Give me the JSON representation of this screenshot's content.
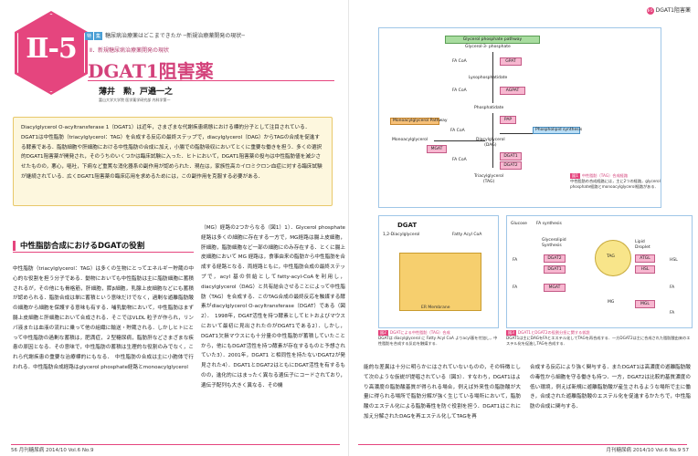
{
  "left_page": {
    "chapter": "Ⅱ-5",
    "series_tags": [
      "特",
      "集"
    ],
    "series_title": "糖尿病治療薬はどこまできたか ─新規治療薬開発の現状─",
    "sub_series": "Ⅱ．新規糖尿病治療薬開発の現状",
    "title": "DGAT1阻害薬",
    "authors": "薄井　勲，戸邉一之",
    "affiliation": "富山大学大学院 医学薬学研究部 内科学第一",
    "abstract": "Diacylglycerol O-acyltransferase 1（DGAT1）は近年，さまざまな代謝疾患病態における標的分子として注目されている．DGAT1は中性脂肪（triacylglycerol：TAG）を合成する反応の最終ステップで，diacylglycerol（DAG）からTAGの合成を促進する酵素である．脂肪細胞や肝細胞における中性脂肪の合成に加え，小腸での脂肪吸収においてとくに重要な働きを担う．多くの選択的DGAT1阻害薬が開発され，そのうちのいくつかは臨床試験に入った．ヒトにおいて，DGAT1阻害薬の投与は中性脂肪値を減少させたものの，悪心，嘔吐，下痢など重篤な消化器系の副作用が認められた．現在は，家族性高カイロミクロン血症に対する臨床試験が継続されている．広くDGAT1阻害薬の臨床応用を求めるためには，この副作用を克服する必要がある．",
    "section_title": "中性脂肪合成におけるDGATの役割",
    "col1": "中性脂肪（triacylglycerol：TAG）は多くの生物にとってエネルギー貯蔵の中心的な役割を担う分子である．動物においても中性脂肪は主に脂肪細胞に蓄積されるが，その他にも骨格筋，肝細胞，膵β細胞，乳腺上皮細胞などにも蓄積が認められる．脂肪合成は単に蓄積という意味だけでなく，過剰な遊離脂肪酸の細胞から細胞を保護する意味も有する．哺乳動物において，中性脂肪はまず腸上皮細胞と肝細胞において合成される．そこではVLDL 粒子が作られ，リンパ液または血液の流れに乗って他の組織に輸送・貯蔵される．しかしヒトにとって中性脂肪の過剰な蓄積は，肥満症，２型糖尿病，脂肪肝などさまざまな疾患の原因となる．その意味で，中性脂肪の蓄積は生理的な役割のみでなく，これら代謝疾患の重要な治療標的にもなる．　中性脂肪の合成は主に小胞体で行われる．中性脂肪合成経路はglycerol phosphate経路とmonoacylglycerol",
    "col2": "（MG）経路の2つからなる（図1）1）．Glycerol phosphate経路は多くの細胞に存在する一方で，MG経路は腸上皮細胞，肝細胞，脂肪細胞など一部の細胞にのみ存在する．とくに腸上皮細胞において MG 経路は，食事由来の脂肪から中性脂肪を合成する経路となる．両経路ともに，中性脂肪合成の最終ステップで，acyl 基の供給としてfatty-acyl-CoAを利用し，diacylglycerol（DAG）と共有結合させることによって中性脂肪（TAG）を合成する．このTAG合成の最終反応を触媒する酵素がdiacylglycerol O-acyltransferase（DGAT）である（図2）．　1998年，DGAT活性を持つ酵素としてヒトおよびマウスにおいて最初に見出されたのがDGAT1である2）．しかし，DGAT1欠損マウスにも十分量の中性脂肪が蓄積していたことから，他にもDGAT活性を持つ酵素が存在するものと予想されていた3）．2001年，DGAT1 と相同性を持たないDGAT2が発見された4）．DGAT1とDGAT2はともにDGAT活性を有するものの，進化的にはまったく異なる遺伝子にコードされており，遺伝子配列も大きく異なる．その機",
    "footer": "56  月刊糖尿病 2014/10 Vol.6 No.9"
  },
  "right_page": {
    "running_head_num": "Ⅱ-5",
    "running_head": "DGAT1阻害薬",
    "fig1": {
      "label": "図1",
      "title": "中性脂肪（TAG）合成経路",
      "caption": "中性脂肪の合成経路には，主に2つの経路，glycerol phosphate経路とmonoacylglycerol経路がある．",
      "header": "Glycerol phosphate pathway",
      "nodes": [
        "Glycerol-3- phosphate",
        "Lysophosphatidate",
        "Phosphatidate",
        "Diacylglycerol\n(DAG)",
        "Triacylglycerol\n(TAG)",
        "Monoacylglycerol"
      ],
      "enzymes": [
        "GPAT",
        "AGPAT",
        "PAP",
        "MGAT",
        "DGAT1",
        "DGAT2"
      ],
      "fa_coa": "FA CoA",
      "mg_pathway": "Monoacylglycerol\nPathway",
      "phospholipid": "Phospholipid\nsynthesis"
    },
    "fig2": {
      "label": "図2",
      "title": "DGATによる中性脂肪（TAG）合成",
      "caption": "DGATは diacylglycerol に Fatty Acyl CoA よりacyl基を付加し，中性脂肪を合成する反応を触媒する．",
      "enzyme": "DGAT",
      "substrate": "1,2-Diacylglycerol",
      "donor": "Fatty Acyl CoA",
      "membrane": "ER Membrane"
    },
    "fig3": {
      "label": "図3",
      "title": "DGAT1とDGAT2の役割分担に関する仮説",
      "caption": "DGAT1は主にDAGをFAとエステル化してTAGを再合成する．一方DGAT2は主に合成された脂肪酸由来のエステル化を促進しTAGを合成する．",
      "labels": [
        "Glucose",
        "FA synthesis",
        "Glycerolipid\nSynthesis",
        "FA",
        "TAG",
        "Lipid\nDroplet",
        "ATGL",
        "HSL",
        "FA",
        "FA",
        "FA",
        "MG",
        "FA"
      ],
      "enzymes": [
        "DGAT2",
        "DGAT1",
        "MGAT",
        "HSL",
        "MGL"
      ]
    },
    "col1": "能的な差異は十分に明らかにはされていないものの，その特徴として次のような仮説が提唱されている（図3）．すなわち，DGAT1はより高濃度の脂肪酸基質が得られる場合，例えば外来性の脂肪酸が大量に得られる場所で脂肪分解が強く生じている場所において，脂肪酸のエステル化による脂肪毒性を防ぐ役割を担う．DGAT1はこれに加え分解されたDAGを再エステル化してTAGを再",
    "col2": "合成する反応により強く関与する．またDGAT1は高濃度の遊離脂肪酸の毒性から細胞を守る働きも持つ．一方，DGAT2は比較的基質濃度の低い環境，例えば新規に遊離脂肪酸が産生されるような場所で主に働き，合成された遊離脂肪酸のエステル化を促進するかたちで，中性脂肪の合成に関与する．",
    "footer": "月刊糖尿病 2014/10 Vol.6 No.9  57"
  },
  "colors": {
    "accent": "#e5457e",
    "abstract_bg": "#fdf7de",
    "figure_border": "#9fc6e7"
  }
}
